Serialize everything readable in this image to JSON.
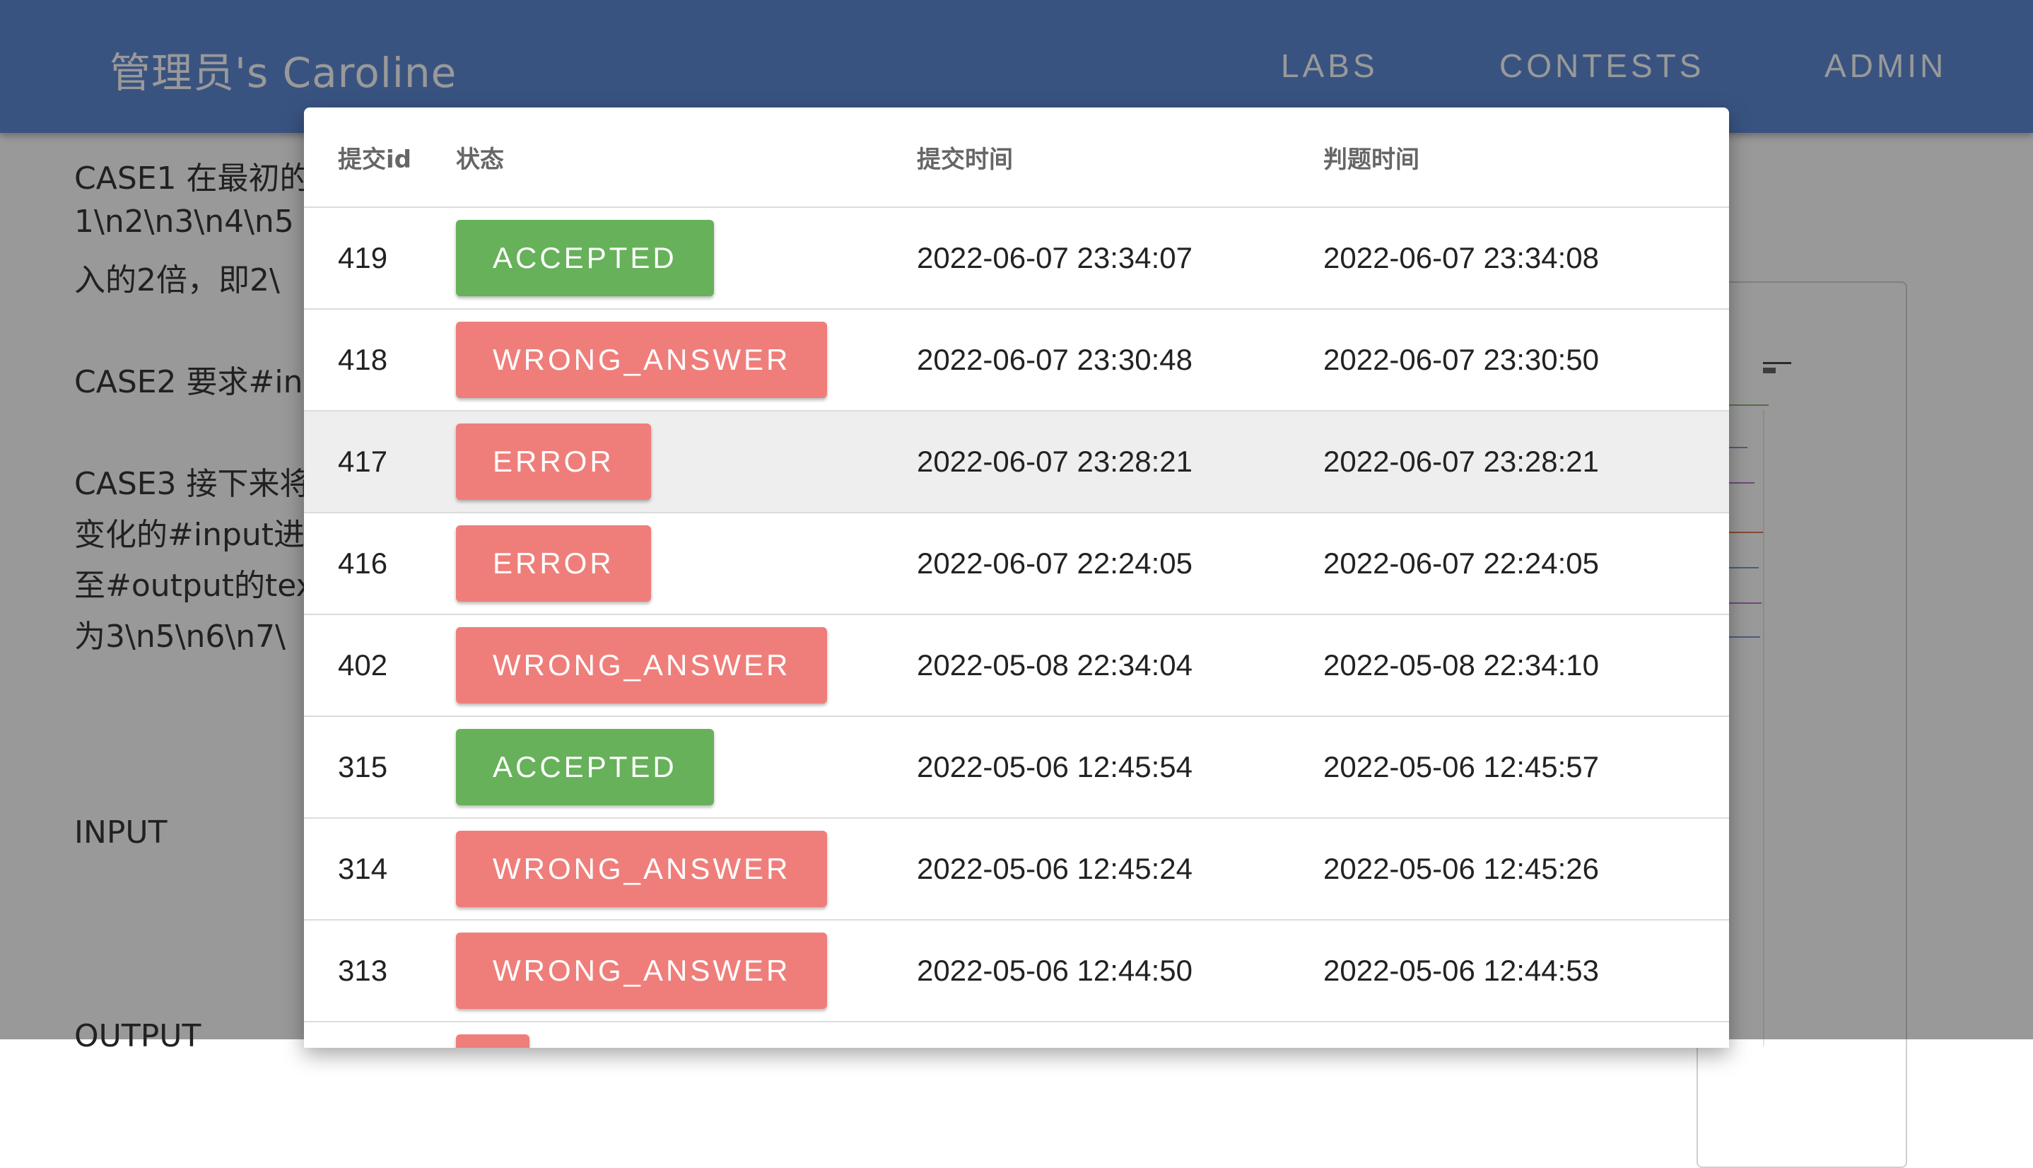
{
  "header": {
    "title": "管理员's Caroline",
    "nav": [
      "LABS",
      "CONTESTS",
      "ADMIN"
    ],
    "color": "#4e7fd2"
  },
  "background": {
    "lines": [
      "CASE1 在最初的",
      "1\\n2\\n3\\n4\\n5",
      "入的2倍，即2\\",
      "CASE2 要求#in",
      "CASE3 接下来将",
      "变化的#input进",
      "至#output的tex",
      "为3\\n5\\n6\\n7\\",
      "INPUT",
      "OUTPUT"
    ]
  },
  "dialog": {
    "columns": [
      "提交id",
      "状态",
      "提交时间",
      "判题时间"
    ],
    "status_colors": {
      "ACCEPTED": "#66b159",
      "WRONG_ANSWER": "#ef7e7a",
      "ERROR": "#ef7e7a"
    },
    "rows": [
      {
        "id": "419",
        "status": "ACCEPTED",
        "submit_time": "2022-06-07 23:34:07",
        "judge_time": "2022-06-07 23:34:08"
      },
      {
        "id": "418",
        "status": "WRONG_ANSWER",
        "submit_time": "2022-06-07 23:30:48",
        "judge_time": "2022-06-07 23:30:50"
      },
      {
        "id": "417",
        "status": "ERROR",
        "submit_time": "2022-06-07 23:28:21",
        "judge_time": "2022-06-07 23:28:21"
      },
      {
        "id": "416",
        "status": "ERROR",
        "submit_time": "2022-06-07 22:24:05",
        "judge_time": "2022-06-07 22:24:05"
      },
      {
        "id": "402",
        "status": "WRONG_ANSWER",
        "submit_time": "2022-05-08 22:34:04",
        "judge_time": "2022-05-08 22:34:10"
      },
      {
        "id": "315",
        "status": "ACCEPTED",
        "submit_time": "2022-05-06 12:45:54",
        "judge_time": "2022-05-06 12:45:57"
      },
      {
        "id": "314",
        "status": "WRONG_ANSWER",
        "submit_time": "2022-05-06 12:45:24",
        "judge_time": "2022-05-06 12:45:26"
      },
      {
        "id": "313",
        "status": "WRONG_ANSWER",
        "submit_time": "2022-05-06 12:44:50",
        "judge_time": "2022-05-06 12:44:53"
      }
    ]
  }
}
